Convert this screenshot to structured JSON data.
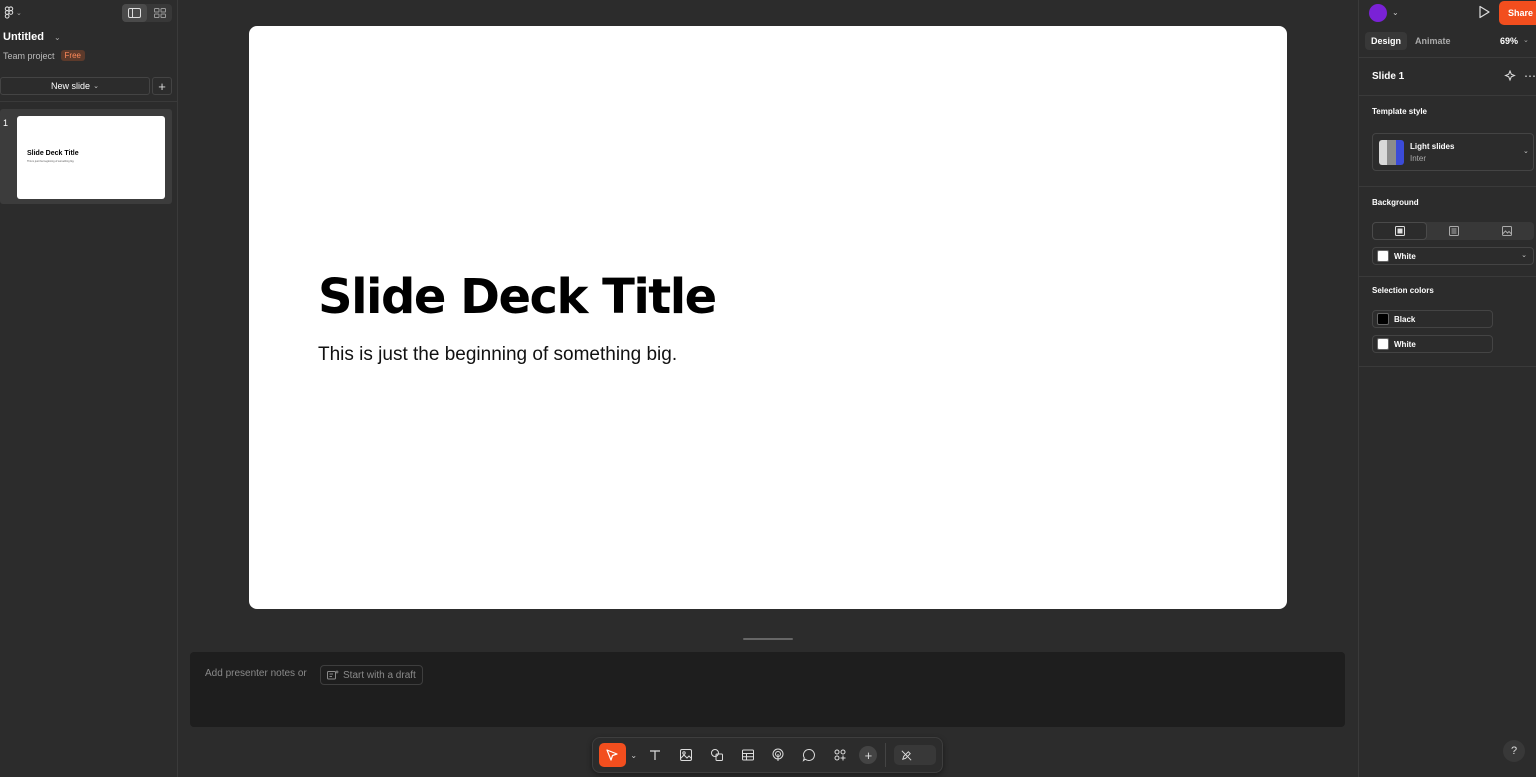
{
  "app": {
    "file_title": "Untitled",
    "project_name": "Team project",
    "plan_badge": "Free"
  },
  "sidebar": {
    "new_slide_label": "New slide",
    "slides": [
      {
        "number": "1",
        "title": "Slide Deck Title",
        "subtitle": "This is just the beginning of something big."
      }
    ]
  },
  "canvas": {
    "title": "Slide Deck Title",
    "subtitle": "This is just the beginning of something big."
  },
  "notes": {
    "placeholder": "Add presenter notes or",
    "draft_button": "Start with a draft"
  },
  "toolbar": {
    "tools": [
      "move-tool",
      "text-tool",
      "image-tool",
      "shapes-tool",
      "table-tool",
      "interactive-tool",
      "comment-tool",
      "components-tool"
    ]
  },
  "right_panel": {
    "share_label": "Share",
    "tabs": [
      "Design",
      "Animate"
    ],
    "zoom": "69%",
    "slide_name": "Slide 1",
    "template_style": {
      "label": "Template style",
      "name": "Light slides",
      "font": "Inter"
    },
    "background": {
      "label": "Background",
      "color_name": "White",
      "color_hex": "#ffffff"
    },
    "selection_colors": {
      "label": "Selection colors",
      "items": [
        {
          "name": "Black",
          "hex": "#000000"
        },
        {
          "name": "White",
          "hex": "#ffffff"
        }
      ]
    },
    "help_label": "?"
  },
  "colors": {
    "accent": "#f24e1e",
    "panel": "#2c2c2c",
    "canvas": "#2c2c2c",
    "notes": "#1e1e1e"
  }
}
